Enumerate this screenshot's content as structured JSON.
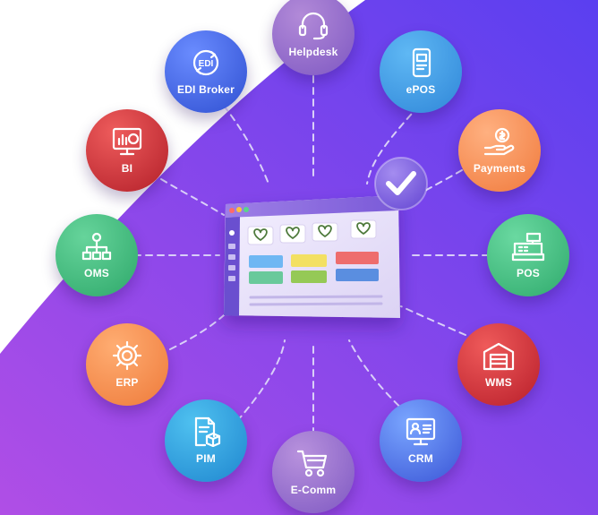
{
  "nodes": [
    {
      "id": "helpdesk",
      "label": "Helpdesk",
      "icon": "headset-icon",
      "colors": [
        "#b28ad8",
        "#7e58c2"
      ]
    },
    {
      "id": "epos",
      "label": "ePOS",
      "icon": "tablet-icon",
      "colors": [
        "#5fb8f4",
        "#2f86d8"
      ]
    },
    {
      "id": "payments",
      "label": "Payments",
      "icon": "hand-coin-icon",
      "colors": [
        "#ffb080",
        "#f07a3c"
      ]
    },
    {
      "id": "pos",
      "label": "POS",
      "icon": "cash-register-icon",
      "colors": [
        "#6ad9a1",
        "#2faa6c"
      ]
    },
    {
      "id": "wms",
      "label": "WMS",
      "icon": "warehouse-icon",
      "colors": [
        "#ef5a5a",
        "#b81e2a"
      ]
    },
    {
      "id": "crm",
      "label": "CRM",
      "icon": "contact-card-monitor-icon",
      "colors": [
        "#7aa6ff",
        "#3a55d6"
      ]
    },
    {
      "id": "ecomm",
      "label": "E-Comm",
      "icon": "shopping-cart-icon",
      "colors": [
        "#b892dd",
        "#7e58c2"
      ]
    },
    {
      "id": "pim",
      "label": "PIM",
      "icon": "document-box-icon",
      "colors": [
        "#4fc1f0",
        "#1f86cf"
      ]
    },
    {
      "id": "erp",
      "label": "ERP",
      "icon": "gear-network-icon",
      "colors": [
        "#ffad72",
        "#ee7a3a"
      ]
    },
    {
      "id": "oms",
      "label": "OMS",
      "icon": "flowchart-gear-icon",
      "colors": [
        "#66d49b",
        "#2ea86a"
      ]
    },
    {
      "id": "bi",
      "label": "BI",
      "icon": "chart-monitor-icon",
      "colors": [
        "#ee5c5c",
        "#b31f29"
      ]
    },
    {
      "id": "edi_broker",
      "label": "EDI Broker",
      "icon": "edi-cycle-icon",
      "colors": [
        "#6a8cff",
        "#2f4fd1"
      ]
    }
  ],
  "hub": {
    "icon": "dashboard-window-icon",
    "badge_icon": "checkmark-badge-icon",
    "window_dot_colors": [
      "#ff6a6a",
      "#ffc23d",
      "#59d68a"
    ],
    "tile_colors": [
      "#6fb7f3",
      "#f3e063",
      "#ee6d6d",
      "#69c99b",
      "#95c956",
      "#5a8ee0"
    ]
  },
  "colors": {
    "bg_purple_start": "#b04ee6",
    "bg_purple_end": "#5a3ff0",
    "connector_line": "#d9cff8"
  }
}
